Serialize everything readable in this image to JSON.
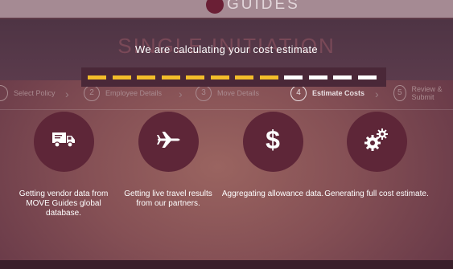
{
  "brand": {
    "name": "GUIDES"
  },
  "hero": {
    "title": "SINGLE INITIATION"
  },
  "loading": {
    "message": "We are calculating your cost estimate",
    "segments_total": 12,
    "segments_done": 8
  },
  "steps": [
    {
      "number": "",
      "label": "Select Policy",
      "state": "inactive"
    },
    {
      "number": "2",
      "label": "Employee Details",
      "state": "inactive"
    },
    {
      "number": "3",
      "label": "Move Details",
      "state": "inactive"
    },
    {
      "number": "4",
      "label": "Estimate Costs",
      "state": "active"
    },
    {
      "number": "5",
      "label": "Review & Submit",
      "state": "inactive"
    }
  ],
  "items": [
    {
      "icon": "truck-icon",
      "caption": "Getting vendor data from MOVE Guides global database."
    },
    {
      "icon": "airplane-icon",
      "caption": "Getting live travel results from our partners."
    },
    {
      "icon": "dollar-icon",
      "caption": "Aggregating allowance data."
    },
    {
      "icon": "gears-icon",
      "caption": "Generating full cost estimate."
    }
  ],
  "colors": {
    "progress_done": "#f3bd2a",
    "progress_todo": "#ffffff",
    "circle": "#5e2638"
  }
}
